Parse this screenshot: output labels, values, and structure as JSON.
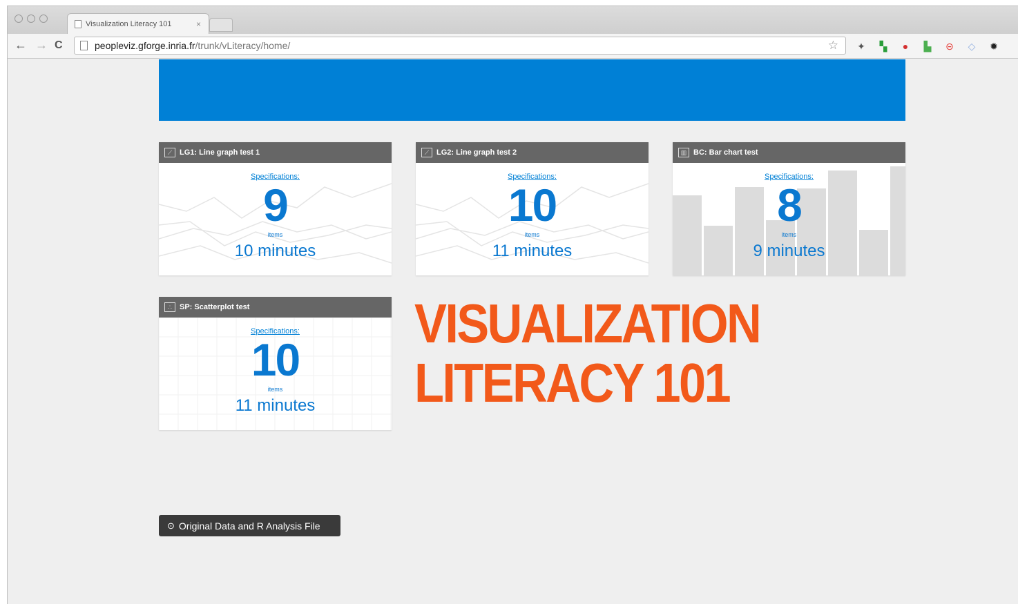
{
  "browser": {
    "tab_title": "Visualization Literacy 101",
    "tab_close": "×",
    "url_host": "peopleviz.gforge.inria.fr",
    "url_path": "/trunk/vLiteracy/home/",
    "star": "☆",
    "nav": {
      "back": "←",
      "forward": "→",
      "reload": "C"
    },
    "extensions": [
      {
        "name": "puzzle-icon",
        "glyph": "✦",
        "color": "#555555"
      },
      {
        "name": "google-icon",
        "glyph": "▚",
        "color": "#2a9d3a"
      },
      {
        "name": "ublock-icon",
        "glyph": "●",
        "color": "#d32f2f"
      },
      {
        "name": "evernote-icon",
        "glyph": "▙",
        "color": "#4caf50"
      },
      {
        "name": "lastpass-icon",
        "glyph": "⊝",
        "color": "#e53935"
      },
      {
        "name": "bookmark-icon",
        "glyph": "◇",
        "color": "#90aee0"
      },
      {
        "name": "settings-icon",
        "glyph": "✹",
        "color": "#222222"
      }
    ]
  },
  "cards": [
    {
      "header": "LG1: Line graph test 1",
      "icon": "line-chart-icon",
      "spec_label": "Specifications:",
      "count": "9",
      "items_label": "items",
      "duration": "10 minutes",
      "bg": "line"
    },
    {
      "header": "LG2: Line graph test 2",
      "icon": "line-chart-icon",
      "spec_label": "Specifications:",
      "count": "10",
      "items_label": "items",
      "duration": "11 minutes",
      "bg": "line"
    },
    {
      "header": "BC: Bar chart test",
      "icon": "bar-chart-icon",
      "spec_label": "Specifications:",
      "count": "8",
      "items_label": "items",
      "duration": "9 minutes",
      "bg": "bar"
    },
    {
      "header": "SP: Scatterplot test",
      "icon": "scatter-icon",
      "spec_label": "Specifications:",
      "count": "10",
      "items_label": "items",
      "duration": "11 minutes",
      "bg": "scatter"
    }
  ],
  "title": {
    "line1": "VISUALIZATION",
    "line2": "LITERACY 101",
    "color": "#f2591a"
  },
  "download_button": "Original Data and R Analysis File",
  "colors": {
    "banner": "#0080d6",
    "card_header": "#666666",
    "accent": "#0a78d0"
  }
}
